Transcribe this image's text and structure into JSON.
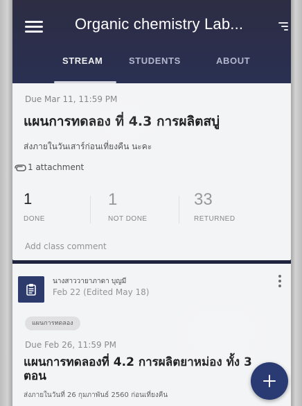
{
  "app_bar": {
    "title": "Organic chemistry Lab..."
  },
  "tabs": [
    {
      "label": "STREAM",
      "active": true
    },
    {
      "label": "STUDENTS",
      "active": false
    },
    {
      "label": "ABOUT",
      "active": false
    }
  ],
  "assignment": {
    "due": "Due Mar 11, 11:59 PM",
    "title": "แผนการทดลอง ที่ 4.3 การผลิตสบู่",
    "subtitle": "ส่งภายในวันเสาร์ก่อนเที่ยงคืน นะคะ",
    "attachments": "1 attachment",
    "stats": [
      {
        "value": "1",
        "label": "DONE"
      },
      {
        "value": "1",
        "label": "NOT DONE"
      },
      {
        "value": "33",
        "label": "RETURNED"
      }
    ],
    "add_comment": "Add class comment"
  },
  "post": {
    "author": "นางสาววายาภาดา บุญมี",
    "date": "Feb 22 (Edited May 18)",
    "tag": "แผนการทดลอง",
    "due": "Due Feb 26, 11:59 PM",
    "title": "แผนการทดลองที่ 4.2 การผลิตยาหม่อง ทั้ง 3 ตอน",
    "subtitle": "ส่งภายในวันที่ 26 กุมภาพันธ์ 2560 ก่อนเที่ยงคืน"
  },
  "fab": {
    "icon": "plus-icon"
  },
  "icons": {
    "menu": "menu-icon",
    "filter": "filter-icon",
    "attachment": "paperclip-icon",
    "assignment": "clipboard-icon",
    "more": "more-vertical-icon"
  },
  "colors": {
    "app_bar": "#2a3052",
    "card_bg": "#f3f4f6",
    "accent": "#2a3a72"
  }
}
